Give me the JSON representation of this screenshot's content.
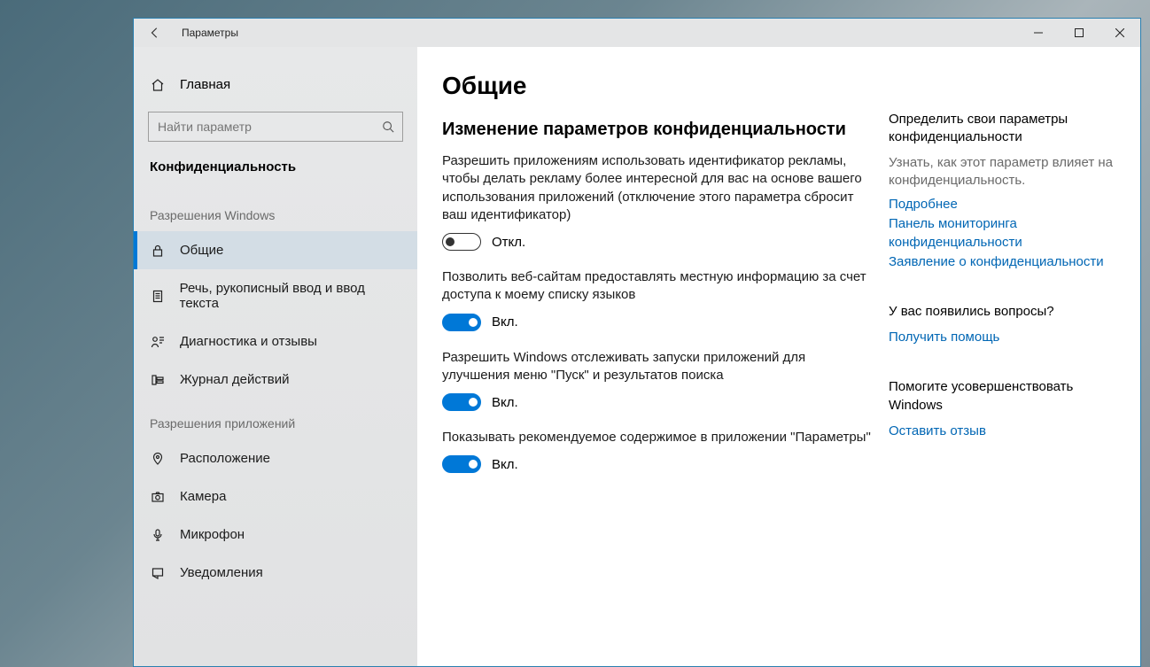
{
  "window": {
    "title": "Параметры"
  },
  "sidebar": {
    "home": "Главная",
    "search_placeholder": "Найти параметр",
    "category": "Конфиденциальность",
    "section_windows": "Разрешения Windows",
    "section_apps": "Разрешения приложений",
    "items_windows": [
      {
        "label": "Общие"
      },
      {
        "label": "Речь, рукописный ввод и ввод текста"
      },
      {
        "label": "Диагностика и отзывы"
      },
      {
        "label": "Журнал действий"
      }
    ],
    "items_apps": [
      {
        "label": "Расположение"
      },
      {
        "label": "Камера"
      },
      {
        "label": "Микрофон"
      },
      {
        "label": "Уведомления"
      }
    ]
  },
  "main": {
    "title": "Общие",
    "subheading": "Изменение параметров конфиденциальности",
    "labels": {
      "on": "Вкл.",
      "off": "Откл."
    },
    "settings": [
      {
        "desc": "Разрешить приложениям использовать идентификатор рекламы, чтобы делать рекламу более интересной для вас на основе вашего использования приложений (отключение этого параметра сбросит ваш идентификатор)",
        "state": "off"
      },
      {
        "desc": "Позволить веб-сайтам предоставлять местную информацию за счет доступа к моему списку языков",
        "state": "on"
      },
      {
        "desc": "Разрешить Windows отслеживать запуски приложений для улучшения меню \"Пуск\" и результатов поиска",
        "state": "on"
      },
      {
        "desc": "Показывать рекомендуемое содержимое в приложении \"Параметры\"",
        "state": "on"
      }
    ]
  },
  "aside": {
    "block1": {
      "title": "Определить свои параметры конфиденциальности",
      "muted": "Узнать, как этот параметр влияет на конфиденциальность.",
      "links": [
        "Подробнее",
        "Панель мониторинга конфиденциальности",
        "Заявление о конфиденциальности"
      ]
    },
    "block2": {
      "title": "У вас появились вопросы?",
      "link": "Получить помощь"
    },
    "block3": {
      "title": "Помогите усовершенствовать Windows",
      "link": "Оставить отзыв"
    }
  }
}
